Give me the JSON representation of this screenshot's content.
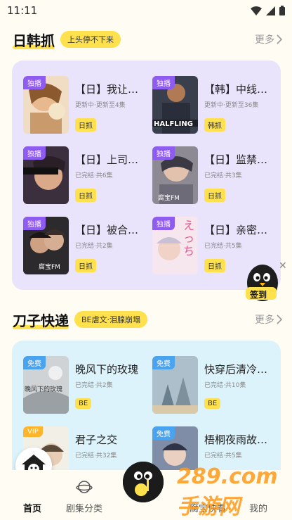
{
  "status_bar": {
    "time": "11:11"
  },
  "sections": [
    {
      "title": "日韩抓",
      "tag": "上头停不下来",
      "more": "更多",
      "cards": [
        {
          "badge": "独播",
          "title": "【日】我让…",
          "meta": "更新中·更新至4集",
          "tag": "日抓"
        },
        {
          "badge": "独播",
          "title": "【韩】中线…",
          "meta": "更新中·更新至36集",
          "tag": "韩抓"
        },
        {
          "badge": "独播",
          "title": "【日】上司…",
          "meta": "已完结·共6集",
          "tag": "日抓"
        },
        {
          "badge": "独播",
          "title": "【日】监禁…",
          "meta": "已完结·共3集",
          "tag": "日抓"
        },
        {
          "badge": "独播",
          "title": "【日】被合…",
          "meta": "已完结·共2集",
          "tag": "日抓"
        },
        {
          "badge": "独播",
          "title": "【日】亲密…",
          "meta": "已完结·共5集",
          "tag": "日抓"
        }
      ]
    },
    {
      "title": "刀子快递",
      "tag": "BE虐文·泪腺崩塌",
      "more": "更多",
      "cards": [
        {
          "badge": "免费",
          "title": "晚风下的玫瑰",
          "meta": "已完结·共2集",
          "tag": "BE"
        },
        {
          "badge": "免费",
          "title": "快穿后清冷…",
          "meta": "已完结·共10集",
          "tag": "BE"
        },
        {
          "badge": "VIP",
          "title": "君子之交",
          "meta": "已完结·共32集",
          "tag": ""
        },
        {
          "badge": "免费",
          "title": "梧桐夜雨故…",
          "meta": "已完结·共5集",
          "tag": ""
        }
      ]
    }
  ],
  "cover_text": {
    "c2": "HALFLING",
    "c4": "腐宝FM",
    "c5": "腐宝FM",
    "c6": "えっち",
    "c7": "晚风下的玫瑰"
  },
  "signin": {
    "label": "签到"
  },
  "watermark": "289.com 手游网",
  "bottom_nav": [
    {
      "label": "首页",
      "active": true
    },
    {
      "label": "剧集分类",
      "active": false
    },
    {
      "label": "",
      "active": false
    },
    {
      "label": "腐宝快看",
      "active": false
    },
    {
      "label": "我的",
      "active": false
    }
  ],
  "colors": {
    "accent_yellow": "#ffe14d",
    "exclusive_badge": "#8e5cf0",
    "free_badge": "#4aa3ee",
    "vip_badge": "#ffb52b",
    "panel_purple": "#e9e3fb",
    "panel_blue": "#ddf3fb"
  }
}
